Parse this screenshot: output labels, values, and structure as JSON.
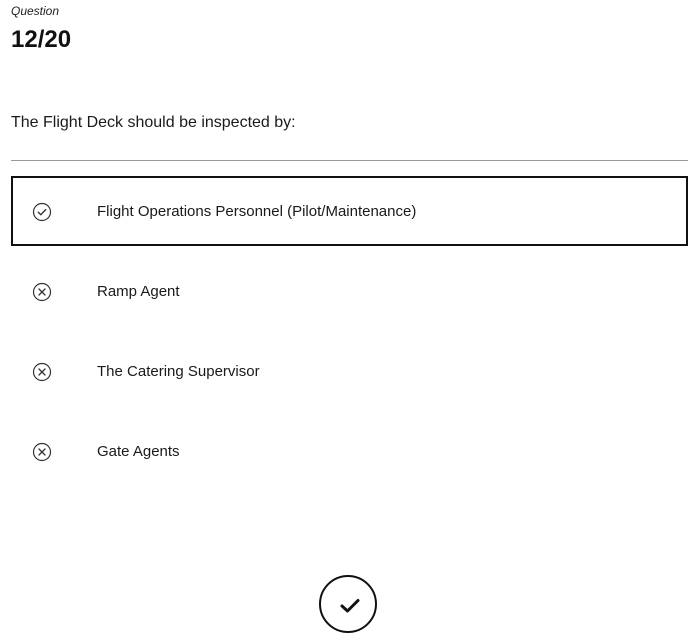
{
  "header": {
    "label": "Question",
    "counter": "12/20"
  },
  "question": {
    "text": "The Flight Deck should be inspected by:"
  },
  "answers": [
    {
      "label": "Flight Operations Personnel (Pilot/Maintenance)",
      "state": "correct",
      "icon": "check-circle-icon",
      "selected": true
    },
    {
      "label": "Ramp Agent",
      "state": "incorrect",
      "icon": "x-circle-icon",
      "selected": false
    },
    {
      "label": "The Catering Supervisor",
      "state": "incorrect",
      "icon": "x-circle-icon",
      "selected": false
    },
    {
      "label": "Gate Agents",
      "state": "incorrect",
      "icon": "x-circle-icon",
      "selected": false
    }
  ],
  "submit": {
    "icon": "checkmark-icon"
  },
  "colors": {
    "text": "#1a1a1a",
    "border": "#111111",
    "divider": "#9a9a9a",
    "background": "#ffffff"
  }
}
